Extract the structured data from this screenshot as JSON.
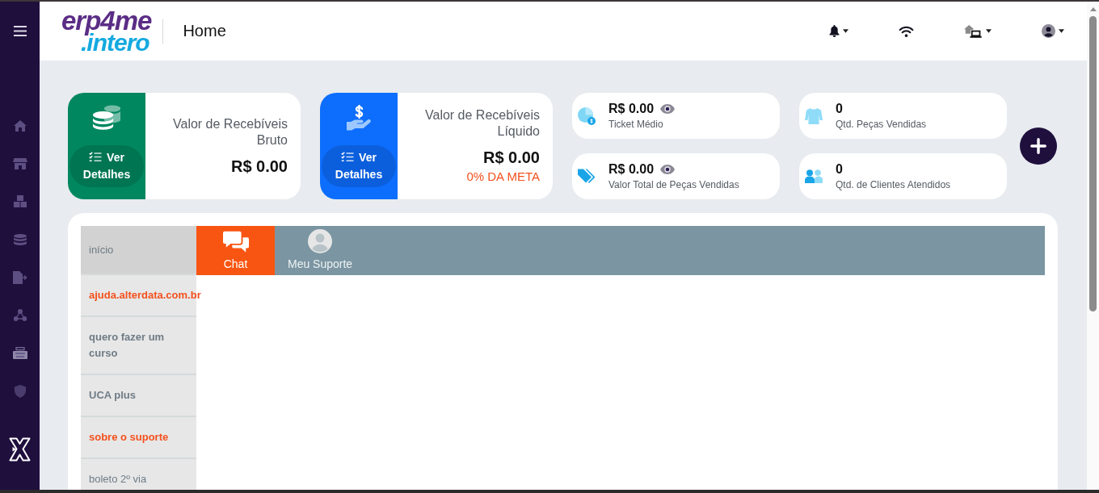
{
  "header": {
    "logo": {
      "top": "erp4me",
      "bottom": ".intero"
    },
    "title": "Home"
  },
  "summary_cards": [
    {
      "kind": "gross",
      "color": "#00875f",
      "button": "Ver Detalhes",
      "title": "Valor de Recebíveis Bruto",
      "value": "R$ 0.00"
    },
    {
      "kind": "net",
      "color": "#0d6efd",
      "button": "Ver Detalhes",
      "title": "Valor de Recebíveis Líquido",
      "value": "R$ 0.00",
      "goal": "0% DA META"
    }
  ],
  "stat_cards": [
    {
      "kind": "ticket",
      "value": "R$ 0.00",
      "label": "Ticket Médio"
    },
    {
      "kind": "pieces",
      "value": "0",
      "label": "Qtd. Peças Vendidas"
    },
    {
      "kind": "total",
      "value": "R$ 0.00",
      "label": "Valor Total de Peças Vendidas"
    },
    {
      "kind": "clients",
      "value": "0",
      "label": "Qtd. de Clientes Atendidos"
    }
  ],
  "support": {
    "menu": [
      {
        "label": "início",
        "kind": "plain",
        "selected": true
      },
      {
        "label": "ajuda.alterdata.com.br",
        "kind": "accent",
        "selected": false
      },
      {
        "label": "quero fazer um curso",
        "kind": "bold",
        "selected": false
      },
      {
        "label": "UCA plus",
        "kind": "bold",
        "selected": false
      },
      {
        "label": "sobre o suporte",
        "kind": "accent",
        "selected": false
      },
      {
        "label": "boleto 2º via",
        "kind": "plain",
        "selected": false
      }
    ],
    "tabs": [
      {
        "label": "Chat",
        "kind": "chat",
        "selected": true
      },
      {
        "label": "Meu Suporte",
        "kind": "profile",
        "selected": false
      }
    ]
  }
}
